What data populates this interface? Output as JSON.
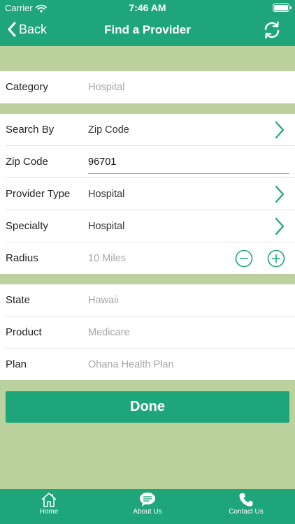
{
  "status_bar": {
    "carrier": "Carrier",
    "time": "7:46 AM"
  },
  "nav": {
    "back_label": "Back",
    "title": "Find a Provider",
    "refresh_icon": "refresh-icon"
  },
  "colors": {
    "accent": "#1fa57a",
    "background": "#bcd29e",
    "stepper": "#1fa57a"
  },
  "category": {
    "label": "Category",
    "placeholder": "Hospital"
  },
  "search": {
    "search_by": {
      "label": "Search By",
      "value": "Zip Code"
    },
    "zip_code": {
      "label": "Zip Code",
      "value": "96701"
    },
    "provider_type": {
      "label": "Provider Type",
      "value": "Hospital"
    },
    "specialty": {
      "label": "Specialty",
      "value": "Hospital"
    },
    "radius": {
      "label": "Radius",
      "value": "10 Miles"
    }
  },
  "location": {
    "state": {
      "label": "State",
      "value": "Hawaii"
    },
    "product": {
      "label": "Product",
      "value": "Medicare"
    },
    "plan": {
      "label": "Plan",
      "value": "Ohana Health Plan"
    }
  },
  "done_label": "Done",
  "tabbar": [
    {
      "label": "Home",
      "icon": "home-icon"
    },
    {
      "label": "About Us",
      "icon": "chat-icon"
    },
    {
      "label": "Contact Us",
      "icon": "phone-icon"
    }
  ]
}
